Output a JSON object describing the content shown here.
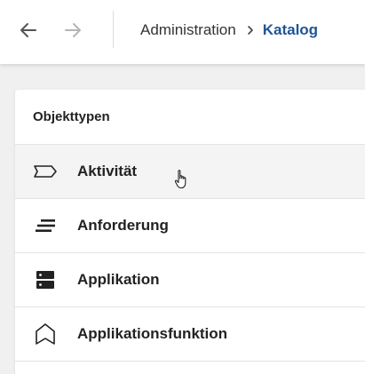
{
  "header": {
    "back_icon": "arrow-left-icon",
    "forward_icon": "arrow-right-icon",
    "breadcrumb": {
      "items": [
        "Administration",
        "Katalog"
      ],
      "separator_icon": "chevron-right-icon"
    }
  },
  "panel": {
    "title": "Objekttypen",
    "items": [
      {
        "label": "Aktivität",
        "icon": "tag-outline-icon"
      },
      {
        "label": "Anforderung",
        "icon": "text-lines-icon"
      },
      {
        "label": "Applikation",
        "icon": "server-icon"
      },
      {
        "label": "Applikationsfunktion",
        "icon": "pentagon-outline-icon"
      }
    ]
  },
  "colors": {
    "accent": "#1f5596",
    "text": "#222222",
    "background": "#f0f0f0"
  }
}
